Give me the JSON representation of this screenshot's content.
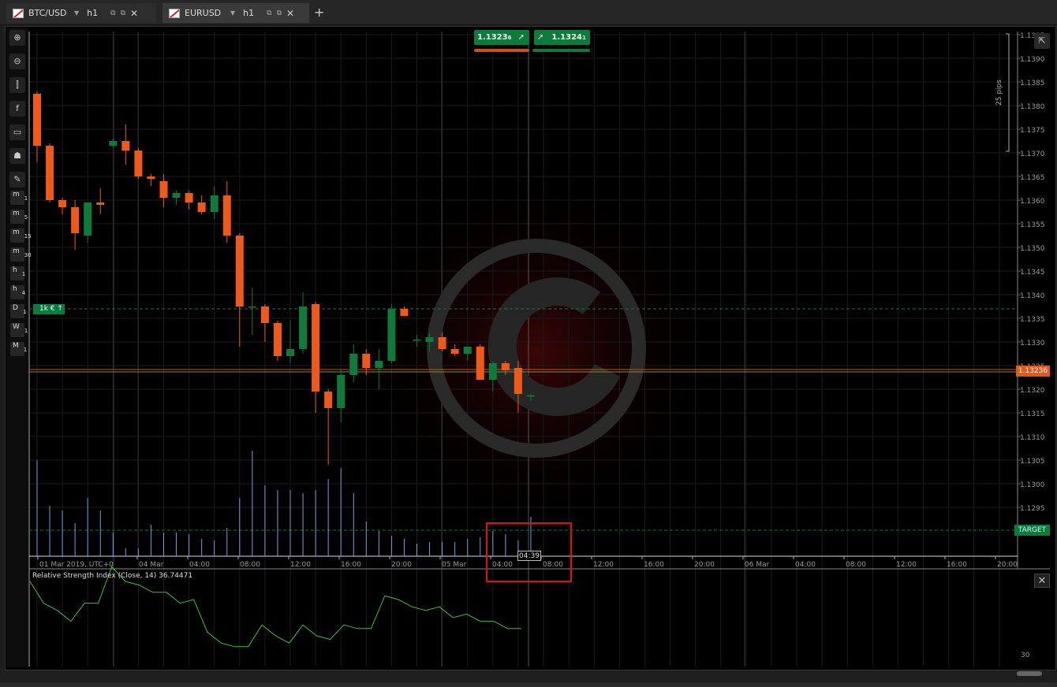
{
  "tabs": [
    {
      "symbol": "BTC/USD",
      "timeframe": "h1",
      "active": false
    },
    {
      "symbol": "EURUSD",
      "timeframe": "h1",
      "active": true
    }
  ],
  "toolbar": {
    "tools": [
      "zoom-in-icon",
      "zoom-out-icon",
      "candlestick-icon",
      "facebook-icon",
      "chat-icon",
      "robot-icon",
      "settings-icon"
    ],
    "timeframes": [
      {
        "main": "m",
        "sub": "1"
      },
      {
        "main": "m",
        "sub": "5"
      },
      {
        "main": "m",
        "sub": "15"
      },
      {
        "main": "m",
        "sub": "30"
      },
      {
        "main": "h",
        "sub": "1"
      },
      {
        "main": "h",
        "sub": "4"
      },
      {
        "main": "D",
        "sub": "1"
      },
      {
        "main": "W",
        "sub": "1"
      },
      {
        "main": "M",
        "sub": "1"
      }
    ]
  },
  "quote": {
    "sell": "1.1323",
    "sell_small": "6",
    "buy": "1.1324",
    "buy_small": "1"
  },
  "position_tag": "1k € ↑",
  "current_price": "1.13236",
  "target_label": "TARGET",
  "pips_label": "25 pips",
  "price_axis": [
    "1.1395",
    "1.1390",
    "1.1385",
    "1.1380",
    "1.1375",
    "1.1370",
    "1.1365",
    "1.1360",
    "1.1355",
    "1.1350",
    "1.1345",
    "1.1340",
    "1.1335",
    "1.1330",
    "1.1325",
    "1.1320",
    "1.1315",
    "1.1310",
    "1.1305",
    "1.1300",
    "1.1295"
  ],
  "time_axis": [
    "01 Mar 2019, UTC+0",
    "04 Mar",
    "04:00",
    "08:00",
    "12:00",
    "16:00",
    "20:00",
    "05 Mar",
    "04:00",
    "08:00",
    "12:00",
    "16:00",
    "20:00",
    "06 Mar",
    "04:00",
    "08:00",
    "12:00",
    "16:00",
    "20:00"
  ],
  "time_cursor": "04:39",
  "rsi": {
    "label": "Relative Strength Index (Close, 14) 36.74471",
    "level": "30",
    "values": [
      50,
      44,
      42,
      39,
      44,
      44,
      54,
      50,
      49,
      47,
      47,
      44,
      45,
      36,
      33,
      32,
      32,
      38,
      35,
      33,
      38,
      35,
      34,
      38,
      37,
      37,
      46,
      45,
      43,
      42,
      43,
      40,
      41,
      39,
      39,
      37,
      37
    ]
  },
  "candles": [
    [
      1.13875,
      1.1388,
      1.1373,
      1.13765
    ],
    [
      1.13765,
      1.1377,
      1.13645,
      1.1365
    ],
    [
      1.1365,
      1.13655,
      1.1362,
      1.13635
    ],
    [
      1.13635,
      1.1365,
      1.13545,
      1.1358
    ],
    [
      1.13575,
      1.13645,
      1.1356,
      1.13645
    ],
    [
      1.13645,
      1.13675,
      1.1362,
      1.1364
    ],
    [
      1.13765,
      1.1378,
      1.1376,
      1.13775
    ],
    [
      1.13775,
      1.1381,
      1.13725,
      1.13755
    ],
    [
      1.13755,
      1.1376,
      1.13695,
      1.137
    ],
    [
      1.137,
      1.13705,
      1.1368,
      1.13695
    ],
    [
      1.1369,
      1.13705,
      1.13635,
      1.13655
    ],
    [
      1.13655,
      1.1367,
      1.1364,
      1.13665
    ],
    [
      1.13665,
      1.1367,
      1.1363,
      1.13645
    ],
    [
      1.13645,
      1.1366,
      1.1362,
      1.13625
    ],
    [
      1.13625,
      1.1368,
      1.1361,
      1.1366
    ],
    [
      1.1366,
      1.1369,
      1.1356,
      1.13575
    ],
    [
      1.13575,
      1.1358,
      1.1334,
      1.13425
    ],
    [
      1.13425,
      1.13465,
      1.13365,
      1.13425
    ],
    [
      1.13425,
      1.1343,
      1.1335,
      1.1339
    ],
    [
      1.1339,
      1.13395,
      1.1331,
      1.1332
    ],
    [
      1.1332,
      1.13395,
      1.13305,
      1.13335
    ],
    [
      1.13335,
      1.13455,
      1.13325,
      1.13425
    ],
    [
      1.1343,
      1.13435,
      1.132,
      1.13245
    ],
    [
      1.13245,
      1.1325,
      1.1309,
      1.1321
    ],
    [
      1.1321,
      1.1329,
      1.1318,
      1.1328
    ],
    [
      1.1328,
      1.13345,
      1.13265,
      1.13325
    ],
    [
      1.13325,
      1.13335,
      1.1328,
      1.13295
    ],
    [
      1.13295,
      1.13335,
      1.1325,
      1.1331
    ],
    [
      1.1331,
      1.1343,
      1.13305,
      1.1342
    ],
    [
      1.1342,
      1.13425,
      1.13405,
      1.13405
    ],
    [
      1.13355,
      1.13365,
      1.1334,
      1.13355
    ],
    [
      1.1335,
      1.1337,
      1.1333,
      1.1336
    ],
    [
      1.1336,
      1.1337,
      1.1333,
      1.13335
    ],
    [
      1.13335,
      1.13345,
      1.1332,
      1.13325
    ],
    [
      1.13325,
      1.1334,
      1.1331,
      1.1334
    ],
    [
      1.1334,
      1.13345,
      1.1327,
      1.1327
    ],
    [
      1.1327,
      1.1331,
      1.13245,
      1.13305
    ],
    [
      1.13305,
      1.1331,
      1.1328,
      1.1329
    ],
    [
      1.13295,
      1.1331,
      1.132,
      1.1324
    ],
    [
      1.13235,
      1.1324,
      1.13225,
      1.13237
    ]
  ],
  "volumes": [
    122,
    64,
    58,
    42,
    74,
    58,
    30,
    10,
    10,
    40,
    30,
    30,
    28,
    22,
    20,
    36,
    74,
    134,
    90,
    84,
    84,
    80,
    84,
    98,
    112,
    80,
    44,
    32,
    26,
    22,
    16,
    18,
    18,
    18,
    22,
    24,
    32,
    28,
    20,
    50
  ]
}
